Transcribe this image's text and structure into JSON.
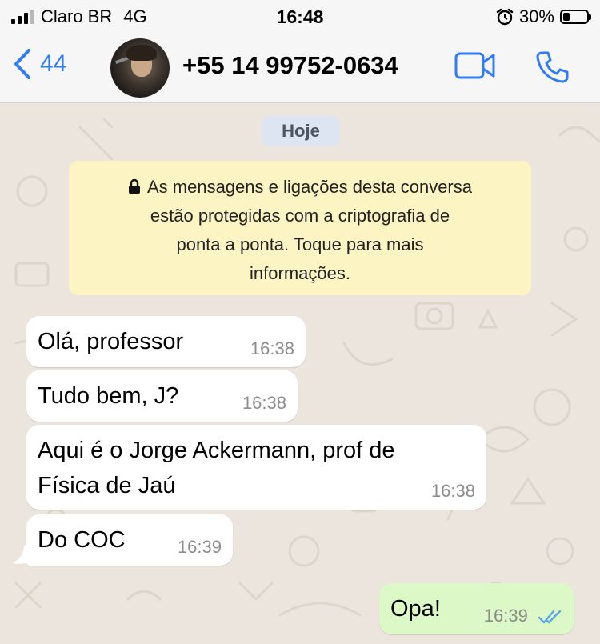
{
  "status_bar": {
    "carrier": "Claro BR",
    "network": "4G",
    "time": "16:48",
    "battery_percent": "30%",
    "battery_level": 0.3,
    "icons": [
      "signal-icon",
      "alarm-icon",
      "battery-icon"
    ]
  },
  "header": {
    "back_count": "44",
    "contact_name": "+55 14 99752-0634",
    "icons": [
      "back-chevron-icon",
      "video-call-icon",
      "phone-call-icon"
    ],
    "accent_color": "#2f7cf6"
  },
  "chat": {
    "date_label": "Hoje",
    "encryption_notice": {
      "lines": [
        "As mensagens e ligações desta conversa",
        "estão protegidas com a criptografia de",
        "ponta a ponta. Toque para mais",
        "informações."
      ],
      "icon": "lock-icon"
    },
    "messages": [
      {
        "direction": "in",
        "lines": [
          "Olá, professor"
        ],
        "time": "16:38"
      },
      {
        "direction": "in",
        "lines": [
          "Tudo bem, J?"
        ],
        "time": "16:38"
      },
      {
        "direction": "in",
        "lines": [
          "Aqui é o Jorge Ackermann, prof de",
          "Física de Jaú"
        ],
        "time": "16:38"
      },
      {
        "direction": "in",
        "lines": [
          "Do COC"
        ],
        "time": "16:39"
      },
      {
        "direction": "out",
        "lines": [
          "Opa!"
        ],
        "time": "16:39",
        "status_icon": "double-check-icon"
      }
    ],
    "colors": {
      "incoming_bubble": "#ffffff",
      "outgoing_bubble": "#dcf8c6",
      "notice_bg": "#fdf4c4",
      "read_ticks": "#5aa6e8"
    }
  }
}
